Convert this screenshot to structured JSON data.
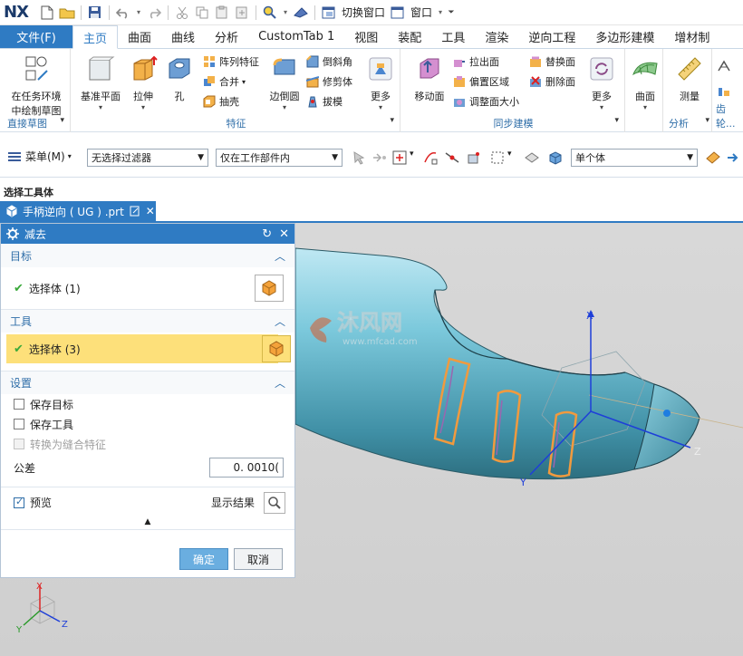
{
  "app": {
    "logo": "NX"
  },
  "quick_access": {
    "switch_window": "切换窗口",
    "window_menu": "窗口"
  },
  "tabs": [
    {
      "label": "文件(F)"
    },
    {
      "label": "主页"
    },
    {
      "label": "曲面"
    },
    {
      "label": "曲线"
    },
    {
      "label": "分析"
    },
    {
      "label": "CustomTab 1"
    },
    {
      "label": "视图"
    },
    {
      "label": "装配"
    },
    {
      "label": "工具"
    },
    {
      "label": "渲染"
    },
    {
      "label": "逆向工程"
    },
    {
      "label": "多边形建模"
    },
    {
      "label": "增材制"
    }
  ],
  "ribbon": {
    "sketch": {
      "label_line1": "在任务环境",
      "label_line2": "中绘制草图",
      "group": "直接草图"
    },
    "feature": {
      "group": "特征",
      "datum_plane": "基准平面",
      "extrude": "拉伸",
      "hole": "孔",
      "pattern": "阵列特征",
      "unite": "合并",
      "shell": "抽壳",
      "edge_blend": "边倒圆",
      "chamfer": "倒斜角",
      "trim_body": "修剪体",
      "draft": "拔模",
      "more": "更多"
    },
    "sync": {
      "group": "同步建模",
      "move_face": "移动面",
      "pull_face": "拉出面",
      "offset_region": "偏置区域",
      "resize_face": "调整面大小",
      "replace_face": "替换面",
      "delete_face": "删除面",
      "more": "更多"
    },
    "surface": {
      "label": "曲面"
    },
    "analysis": {
      "group": "分析",
      "measure": "测量"
    },
    "gear": {
      "group": "齿轮..."
    }
  },
  "toolbar": {
    "menu": "菜单(M)",
    "filter": "无选择过滤器",
    "scope": "仅在工作部件内",
    "body_type": "单个体"
  },
  "hint": "选择工具体",
  "document": {
    "tab_label": "手柄逆向 ( UG ) .prt"
  },
  "dialog": {
    "title": "减去",
    "target": {
      "header": "目标",
      "select": "选择体 (1)"
    },
    "tool": {
      "header": "工具",
      "select": "选择体 (3)"
    },
    "settings": {
      "header": "设置",
      "keep_target": "保存目标",
      "keep_tool": "保存工具",
      "convert": "转换为缝合特征",
      "tolerance_label": "公差",
      "tolerance_value": "0. 0010("
    },
    "preview": "预览",
    "show_result": "显示结果",
    "ok": "确定",
    "cancel": "取消"
  },
  "viewport": {
    "watermark": "沐风网",
    "watermark_url": "www.mfcad.com",
    "axes": {
      "x": "X",
      "y": "Y",
      "z": "Z"
    }
  },
  "colors": {
    "accent": "#2f7bc3",
    "highlight": "#fde07a",
    "tool_body": "#f19a3e",
    "model": "#6dbfd2"
  }
}
